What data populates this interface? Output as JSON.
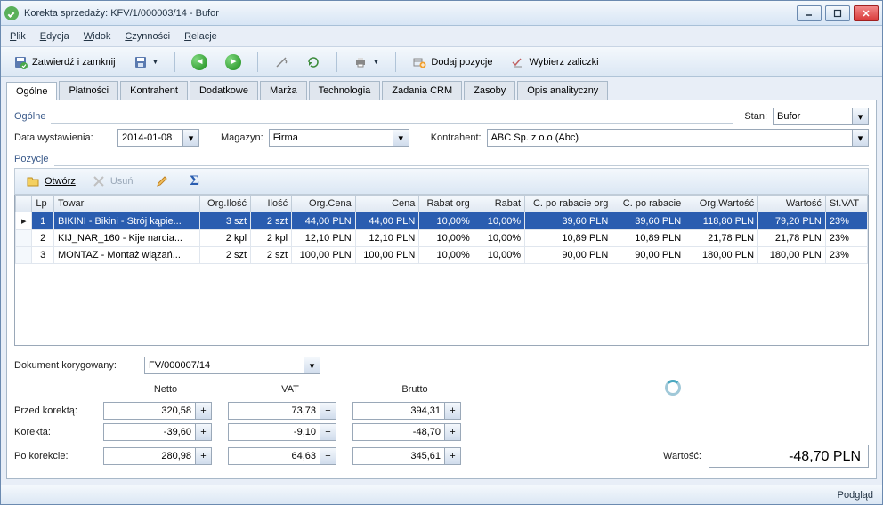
{
  "window": {
    "title": "Korekta sprzedaży: KFV/1/000003/14 - Bufor"
  },
  "menu": {
    "plik": "Plik",
    "edycja": "Edycja",
    "widok": "Widok",
    "czynnosci": "Czynności",
    "relacje": "Relacje"
  },
  "toolbar": {
    "zatwierdz": "Zatwierdź i zamknij",
    "dodaj_pozycje": "Dodaj pozycje",
    "wybierz_zaliczki": "Wybierz zaliczki"
  },
  "tabs": [
    "Ogólne",
    "Płatności",
    "Kontrahent",
    "Dodatkowe",
    "Marża",
    "Technologia",
    "Zadania CRM",
    "Zasoby",
    "Opis analityczny"
  ],
  "ogolne": {
    "section": "Ogólne",
    "stan_label": "Stan:",
    "stan_value": "Bufor",
    "data_label": "Data wystawienia:",
    "data_value": "2014-01-08",
    "magazyn_label": "Magazyn:",
    "magazyn_value": "Firma",
    "kontrahent_label": "Kontrahent:",
    "kontrahent_value": "ABC Sp. z o.o (Abc)"
  },
  "pozycje": {
    "section": "Pozycje",
    "otworz": "Otwórz",
    "usun": "Usuń",
    "columns": [
      "Lp",
      "Towar",
      "Org.Ilość",
      "Ilość",
      "Org.Cena",
      "Cena",
      "Rabat org",
      "Rabat",
      "C. po rabacie org",
      "C. po rabacie",
      "Org.Wartość",
      "Wartość",
      "St.VAT"
    ],
    "rows": [
      {
        "lp": "1",
        "towar": "BIKINI - Bikini - Strój kąpie...",
        "org_ilosc": "3 szt",
        "ilosc": "2 szt",
        "org_cena": "44,00 PLN",
        "cena": "44,00 PLN",
        "rabat_org": "10,00%",
        "rabat": "10,00%",
        "c_po_rab_org": "39,60 PLN",
        "c_po_rab": "39,60 PLN",
        "org_wartosc": "118,80 PLN",
        "wartosc": "79,20 PLN",
        "vat": "23%"
      },
      {
        "lp": "2",
        "towar": "KIJ_NAR_160 - Kije narcia...",
        "org_ilosc": "2 kpl",
        "ilosc": "2 kpl",
        "org_cena": "12,10 PLN",
        "cena": "12,10 PLN",
        "rabat_org": "10,00%",
        "rabat": "10,00%",
        "c_po_rab_org": "10,89 PLN",
        "c_po_rab": "10,89 PLN",
        "org_wartosc": "21,78 PLN",
        "wartosc": "21,78 PLN",
        "vat": "23%"
      },
      {
        "lp": "3",
        "towar": "MONTAZ - Montaż wiązań...",
        "org_ilosc": "2 szt",
        "ilosc": "2 szt",
        "org_cena": "100,00 PLN",
        "cena": "100,00 PLN",
        "rabat_org": "10,00%",
        "rabat": "10,00%",
        "c_po_rab_org": "90,00 PLN",
        "c_po_rab": "90,00 PLN",
        "org_wartosc": "180,00 PLN",
        "wartosc": "180,00 PLN",
        "vat": "23%"
      }
    ]
  },
  "korygowany": {
    "label": "Dokument korygowany:",
    "value": "FV/000007/14"
  },
  "totals": {
    "headers": {
      "netto": "Netto",
      "vat": "VAT",
      "brutto": "Brutto"
    },
    "rows": {
      "przed": {
        "label": "Przed korektą:",
        "netto": "320,58",
        "vat": "73,73",
        "brutto": "394,31"
      },
      "korekta": {
        "label": "Korekta:",
        "netto": "-39,60",
        "vat": "-9,10",
        "brutto": "-48,70"
      },
      "po": {
        "label": "Po korekcie:",
        "netto": "280,98",
        "vat": "64,63",
        "brutto": "345,61"
      }
    },
    "wartosc_label": "Wartość:",
    "wartosc_value": "-48,70 PLN"
  },
  "statusbar": {
    "podglad": "Podgląd"
  }
}
